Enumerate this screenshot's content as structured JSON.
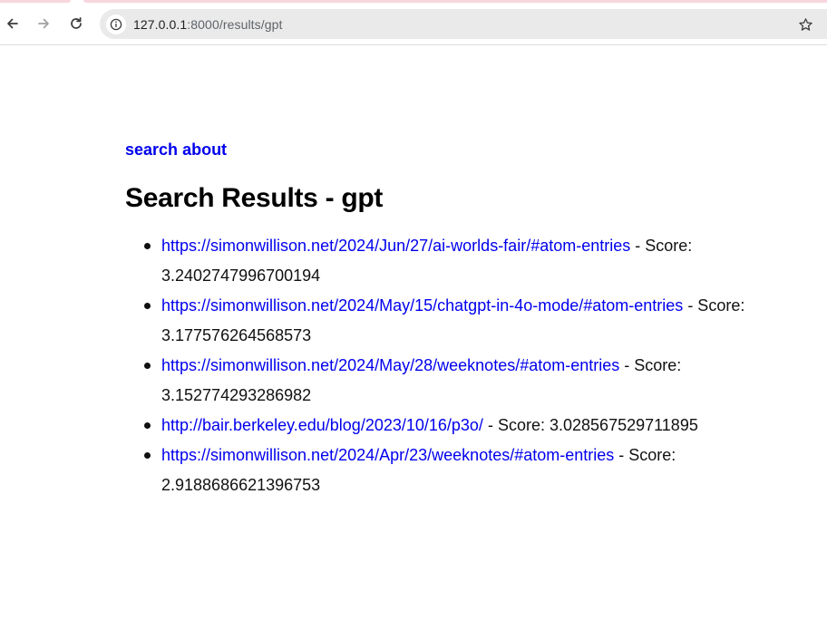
{
  "browser": {
    "url_host": "127.0.0.1",
    "url_path": ":8000/results/gpt",
    "icons": [
      "back-arrow-icon",
      "forward-arrow-icon",
      "reload-icon",
      "info-icon",
      "star-icon"
    ]
  },
  "nav": {
    "search_link": "search",
    "about_link": "about"
  },
  "page": {
    "title": "Search Results - gpt"
  },
  "results": [
    {
      "url": "https://simonwillison.net/2024/Jun/27/ai-worlds-fair/#atom-entries",
      "score_label": "- Score:",
      "score": "3.2402747996700194"
    },
    {
      "url": "https://simonwillison.net/2024/May/15/chatgpt-in-4o-mode/#atom-entries",
      "score_label": "- Score:",
      "score": "3.177576264568573"
    },
    {
      "url": "https://simonwillison.net/2024/May/28/weeknotes/#atom-entries",
      "score_label": "- Score:",
      "score": "3.152774293286982"
    },
    {
      "url": "http://bair.berkeley.edu/blog/2023/10/16/p3o/",
      "score_label": "- Score:",
      "score": "3.028567529711895"
    },
    {
      "url": "https://simonwillison.net/2024/Apr/23/weeknotes/#atom-entries",
      "score_label": "- Score:",
      "score": "2.9188686621396753"
    }
  ],
  "colors": {
    "link": "#0000ee",
    "omnibox": "#eaeaea",
    "tab_hint": "#f7d6de"
  }
}
